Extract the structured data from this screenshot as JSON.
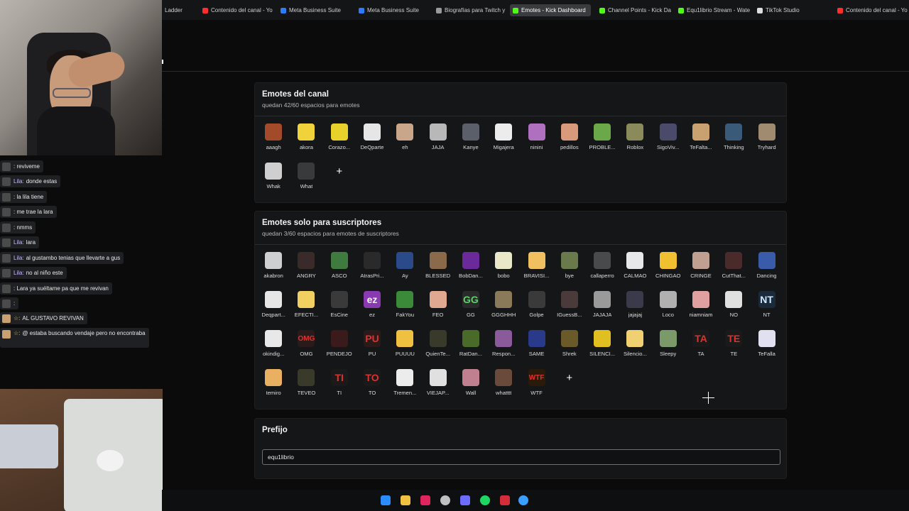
{
  "browser": {
    "tabs": [
      {
        "label": "Ladder",
        "color": "#888888"
      },
      {
        "label": "Contenido del canal - Yo",
        "color": "#ff2d2d"
      },
      {
        "label": "Meta Business Suite",
        "color": "#2d7bff"
      },
      {
        "label": "Meta Business Suite",
        "color": "#2d7bff"
      },
      {
        "label": "Biografías para Twitch y",
        "color": "#9a9a9a"
      },
      {
        "label": "Emotes - Kick Dashboard",
        "color": "#53fc18"
      },
      {
        "label": "Channel Points - Kick Da",
        "color": "#53fc18"
      },
      {
        "label": "Equ1librio Stream - Wate",
        "color": "#53fc18"
      },
      {
        "label": "TikTok Studio",
        "color": "#dddddd"
      },
      {
        "label": "Contenido del canal - Yo",
        "color": "#ff2d2d"
      }
    ],
    "active_tab": 5
  },
  "chat": {
    "messages": [
      {
        "user": "",
        "text": ": reviveme"
      },
      {
        "user": "Lila:",
        "text": "donde estas"
      },
      {
        "user": "",
        "text": ": la lila tiene"
      },
      {
        "user": "",
        "text": ": me trae la lara"
      },
      {
        "user": "",
        "text": ": nmms"
      },
      {
        "user": "Lila:",
        "text": "lara"
      },
      {
        "user": "Lila:",
        "text": "al gustambo tenias que llevarte a gus"
      },
      {
        "user": "Lila:",
        "text": "no al niño este"
      },
      {
        "user": "",
        "text": ": Lara ya suéltame pa que me revivan"
      },
      {
        "user": "",
        "text": ":"
      },
      {
        "user": "☆:",
        "text": "AL GUSTAVO REVIVAN"
      },
      {
        "user": "☆:",
        "text": "@ estaba buscando vendaje pero no encontraba"
      }
    ]
  },
  "channel_emotes": {
    "title": "Emotes del canal",
    "subtitle": "quedan 42/60 espacios para emotes",
    "items": [
      {
        "name": "aaagh",
        "color": "#a34a2a",
        "glyph": ""
      },
      {
        "name": "akora",
        "color": "#f0d23a",
        "glyph": ""
      },
      {
        "name": "Corazo...",
        "color": "#e8d12a",
        "glyph": ""
      },
      {
        "name": "DeQparte",
        "color": "#e6e6e6",
        "glyph": ""
      },
      {
        "name": "eh",
        "color": "#c9a58a",
        "glyph": ""
      },
      {
        "name": "JAJA",
        "color": "#b8b8b8",
        "glyph": ""
      },
      {
        "name": "Kanye",
        "color": "#5a5f6a",
        "glyph": ""
      },
      {
        "name": "Migajera",
        "color": "#ececec",
        "glyph": ""
      },
      {
        "name": "ninini",
        "color": "#b070c0",
        "glyph": ""
      },
      {
        "name": "pedillos",
        "color": "#d89a7a",
        "glyph": ""
      },
      {
        "name": "PROBLE...",
        "color": "#6aa84a",
        "glyph": ""
      },
      {
        "name": "Roblox",
        "color": "#8a8a5a",
        "glyph": ""
      },
      {
        "name": "SigoViv...",
        "color": "#4a4a6a",
        "glyph": ""
      },
      {
        "name": "TeFalta...",
        "color": "#c9a070",
        "glyph": ""
      },
      {
        "name": "Thinking",
        "color": "#3a5a7a",
        "glyph": ""
      },
      {
        "name": "Tryhard",
        "color": "#a08a70",
        "glyph": ""
      },
      {
        "name": "Whak",
        "color": "#cfcfcf",
        "glyph": ""
      },
      {
        "name": "What",
        "color": "#3a3a3a",
        "glyph": ""
      }
    ]
  },
  "sub_emotes": {
    "title": "Emotes solo para suscriptores",
    "subtitle": "quedan 3/60 espacios para emotes de suscriptores",
    "items": [
      {
        "name": "akabron",
        "color": "#cfcfcf",
        "glyph": ""
      },
      {
        "name": "ANGRY",
        "color": "#3a2a2a",
        "glyph": ""
      },
      {
        "name": "ASCO",
        "color": "#3f7a3f",
        "glyph": ""
      },
      {
        "name": "AtrasPri...",
        "color": "#2a2a2a",
        "glyph": ""
      },
      {
        "name": "Ay",
        "color": "#2a4a8a",
        "glyph": ""
      },
      {
        "name": "BLESSED",
        "color": "#8a6a4a",
        "glyph": ""
      },
      {
        "name": "BobDan...",
        "color": "#6a2a9a",
        "glyph": ""
      },
      {
        "name": "bobo",
        "color": "#e8e8c8",
        "glyph": ""
      },
      {
        "name": "BRAVISI...",
        "color": "#f0c060",
        "glyph": ""
      },
      {
        "name": "bye",
        "color": "#6a7a4a",
        "glyph": ""
      },
      {
        "name": "callaperro",
        "color": "#4a4a4a",
        "glyph": ""
      },
      {
        "name": "CALMAO",
        "color": "#e8e8e8",
        "glyph": ""
      },
      {
        "name": "CHINGAO",
        "color": "#f0c030",
        "glyph": ""
      },
      {
        "name": "CRINGE",
        "color": "#c0a090",
        "glyph": ""
      },
      {
        "name": "CutThat...",
        "color": "#4a2a2a",
        "glyph": ""
      },
      {
        "name": "Dancing",
        "color": "#3a5aaa",
        "glyph": ""
      },
      {
        "name": "Deqpart...",
        "color": "#e6e6e6",
        "glyph": ""
      },
      {
        "name": "EFECTI...",
        "color": "#f0d060",
        "glyph": ""
      },
      {
        "name": "EsCine",
        "color": "#3a3a3a",
        "glyph": ""
      },
      {
        "name": "ez",
        "color": "#8a3ab0",
        "glyph": "ez"
      },
      {
        "name": "FakYou",
        "color": "#3a8a3a",
        "glyph": ""
      },
      {
        "name": "FEO",
        "color": "#e0a890",
        "glyph": ""
      },
      {
        "name": "GG",
        "color": "#2a2a2a",
        "glyph": "GG"
      },
      {
        "name": "GGGHHH",
        "color": "#8a7a5a",
        "glyph": ""
      },
      {
        "name": "Golpe",
        "color": "#3a3a3a",
        "glyph": ""
      },
      {
        "name": "IGuessB...",
        "color": "#4a3a3a",
        "glyph": ""
      },
      {
        "name": "JAJAJA",
        "color": "#9a9a9a",
        "glyph": ""
      },
      {
        "name": "jajajaj",
        "color": "#3a3a4a",
        "glyph": ""
      },
      {
        "name": "Loco",
        "color": "#b0b0b0",
        "glyph": ""
      },
      {
        "name": "niamniam",
        "color": "#e0a0a0",
        "glyph": ""
      },
      {
        "name": "NO",
        "color": "#e0e0e0",
        "glyph": ""
      },
      {
        "name": "NT",
        "color": "#1a2a3a",
        "glyph": "NT"
      },
      {
        "name": "okindig...",
        "color": "#e8e8e8",
        "glyph": ""
      },
      {
        "name": "OMG",
        "color": "#2a1a1a",
        "glyph": "OMG"
      },
      {
        "name": "PENDEJO",
        "color": "#3a1a1a",
        "glyph": ""
      },
      {
        "name": "PU",
        "color": "#2a1a1a",
        "glyph": "PU"
      },
      {
        "name": "PUUUU",
        "color": "#f0c040",
        "glyph": ""
      },
      {
        "name": "QuienTe...",
        "color": "#3a3a2a",
        "glyph": ""
      },
      {
        "name": "RatDan...",
        "color": "#4a6a2a",
        "glyph": ""
      },
      {
        "name": "Respon...",
        "color": "#8a5a9a",
        "glyph": ""
      },
      {
        "name": "SAME",
        "color": "#2a3a8a",
        "glyph": ""
      },
      {
        "name": "Shrek",
        "color": "#6a5a2a",
        "glyph": ""
      },
      {
        "name": "SILENCI...",
        "color": "#e0c020",
        "glyph": ""
      },
      {
        "name": "Silencio...",
        "color": "#f0d070",
        "glyph": ""
      },
      {
        "name": "Sleepy",
        "color": "#7a9a6a",
        "glyph": ""
      },
      {
        "name": "TA",
        "color": "#1a1a1a",
        "glyph": "TA"
      },
      {
        "name": "TE",
        "color": "#1a1a1a",
        "glyph": "TE"
      },
      {
        "name": "TeFalla",
        "color": "#e0e0f0",
        "glyph": ""
      },
      {
        "name": "temiro",
        "color": "#e8b060",
        "glyph": ""
      },
      {
        "name": "TEVEO",
        "color": "#3a3a2a",
        "glyph": ""
      },
      {
        "name": "TI",
        "color": "#1a1a1a",
        "glyph": "TI"
      },
      {
        "name": "TO",
        "color": "#1a1a1a",
        "glyph": "TO"
      },
      {
        "name": "Tremen...",
        "color": "#ececec",
        "glyph": ""
      },
      {
        "name": "VIEJAP...",
        "color": "#e0e0e0",
        "glyph": ""
      },
      {
        "name": "Wall",
        "color": "#c08090",
        "glyph": ""
      },
      {
        "name": "whatttt",
        "color": "#6a4a3a",
        "glyph": ""
      },
      {
        "name": "WTF",
        "color": "#2a1a0a",
        "glyph": "WTF"
      }
    ]
  },
  "prefix": {
    "title": "Prefijo",
    "value": "equ1librio"
  },
  "icons": {
    "add": "+"
  },
  "taskbar": [
    {
      "name": "windows-icon",
      "color": "#2b8cff"
    },
    {
      "name": "folder-icon",
      "color": "#f0c040"
    },
    {
      "name": "app-red-icon",
      "color": "#e0245e"
    },
    {
      "name": "chrome-icon",
      "color": "#c0c0c0"
    },
    {
      "name": "discord-icon",
      "color": "#6c6cff"
    },
    {
      "name": "spotify-icon",
      "color": "#1ed760"
    },
    {
      "name": "opera-icon",
      "color": "#d42c3a"
    },
    {
      "name": "app-blue-icon",
      "color": "#3aa0ff"
    }
  ]
}
